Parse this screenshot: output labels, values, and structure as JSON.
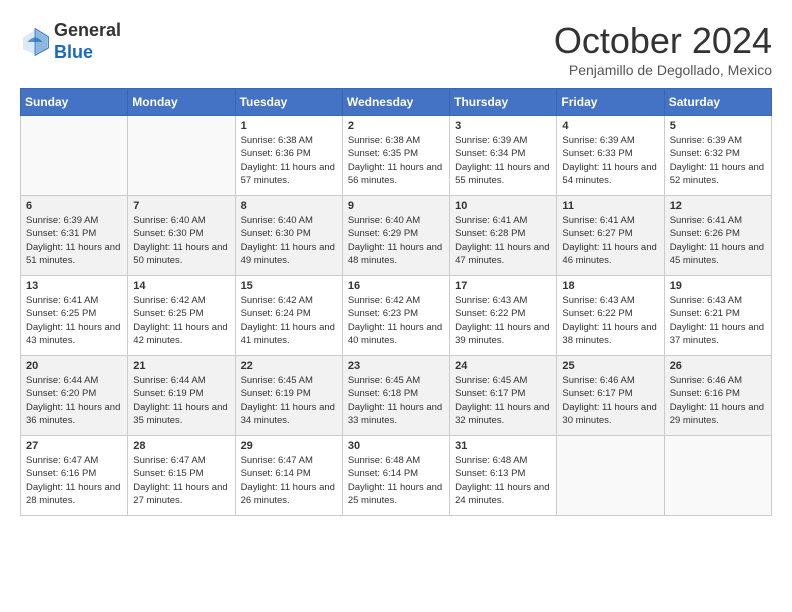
{
  "header": {
    "logo_general": "General",
    "logo_blue": "Blue",
    "month_title": "October 2024",
    "location": "Penjamillo de Degollado, Mexico"
  },
  "days_of_week": [
    "Sunday",
    "Monday",
    "Tuesday",
    "Wednesday",
    "Thursday",
    "Friday",
    "Saturday"
  ],
  "weeks": [
    [
      {
        "day": "",
        "sunrise": "",
        "sunset": "",
        "daylight": ""
      },
      {
        "day": "",
        "sunrise": "",
        "sunset": "",
        "daylight": ""
      },
      {
        "day": "1",
        "sunrise": "Sunrise: 6:38 AM",
        "sunset": "Sunset: 6:36 PM",
        "daylight": "Daylight: 11 hours and 57 minutes."
      },
      {
        "day": "2",
        "sunrise": "Sunrise: 6:38 AM",
        "sunset": "Sunset: 6:35 PM",
        "daylight": "Daylight: 11 hours and 56 minutes."
      },
      {
        "day": "3",
        "sunrise": "Sunrise: 6:39 AM",
        "sunset": "Sunset: 6:34 PM",
        "daylight": "Daylight: 11 hours and 55 minutes."
      },
      {
        "day": "4",
        "sunrise": "Sunrise: 6:39 AM",
        "sunset": "Sunset: 6:33 PM",
        "daylight": "Daylight: 11 hours and 54 minutes."
      },
      {
        "day": "5",
        "sunrise": "Sunrise: 6:39 AM",
        "sunset": "Sunset: 6:32 PM",
        "daylight": "Daylight: 11 hours and 52 minutes."
      }
    ],
    [
      {
        "day": "6",
        "sunrise": "Sunrise: 6:39 AM",
        "sunset": "Sunset: 6:31 PM",
        "daylight": "Daylight: 11 hours and 51 minutes."
      },
      {
        "day": "7",
        "sunrise": "Sunrise: 6:40 AM",
        "sunset": "Sunset: 6:30 PM",
        "daylight": "Daylight: 11 hours and 50 minutes."
      },
      {
        "day": "8",
        "sunrise": "Sunrise: 6:40 AM",
        "sunset": "Sunset: 6:30 PM",
        "daylight": "Daylight: 11 hours and 49 minutes."
      },
      {
        "day": "9",
        "sunrise": "Sunrise: 6:40 AM",
        "sunset": "Sunset: 6:29 PM",
        "daylight": "Daylight: 11 hours and 48 minutes."
      },
      {
        "day": "10",
        "sunrise": "Sunrise: 6:41 AM",
        "sunset": "Sunset: 6:28 PM",
        "daylight": "Daylight: 11 hours and 47 minutes."
      },
      {
        "day": "11",
        "sunrise": "Sunrise: 6:41 AM",
        "sunset": "Sunset: 6:27 PM",
        "daylight": "Daylight: 11 hours and 46 minutes."
      },
      {
        "day": "12",
        "sunrise": "Sunrise: 6:41 AM",
        "sunset": "Sunset: 6:26 PM",
        "daylight": "Daylight: 11 hours and 45 minutes."
      }
    ],
    [
      {
        "day": "13",
        "sunrise": "Sunrise: 6:41 AM",
        "sunset": "Sunset: 6:25 PM",
        "daylight": "Daylight: 11 hours and 43 minutes."
      },
      {
        "day": "14",
        "sunrise": "Sunrise: 6:42 AM",
        "sunset": "Sunset: 6:25 PM",
        "daylight": "Daylight: 11 hours and 42 minutes."
      },
      {
        "day": "15",
        "sunrise": "Sunrise: 6:42 AM",
        "sunset": "Sunset: 6:24 PM",
        "daylight": "Daylight: 11 hours and 41 minutes."
      },
      {
        "day": "16",
        "sunrise": "Sunrise: 6:42 AM",
        "sunset": "Sunset: 6:23 PM",
        "daylight": "Daylight: 11 hours and 40 minutes."
      },
      {
        "day": "17",
        "sunrise": "Sunrise: 6:43 AM",
        "sunset": "Sunset: 6:22 PM",
        "daylight": "Daylight: 11 hours and 39 minutes."
      },
      {
        "day": "18",
        "sunrise": "Sunrise: 6:43 AM",
        "sunset": "Sunset: 6:22 PM",
        "daylight": "Daylight: 11 hours and 38 minutes."
      },
      {
        "day": "19",
        "sunrise": "Sunrise: 6:43 AM",
        "sunset": "Sunset: 6:21 PM",
        "daylight": "Daylight: 11 hours and 37 minutes."
      }
    ],
    [
      {
        "day": "20",
        "sunrise": "Sunrise: 6:44 AM",
        "sunset": "Sunset: 6:20 PM",
        "daylight": "Daylight: 11 hours and 36 minutes."
      },
      {
        "day": "21",
        "sunrise": "Sunrise: 6:44 AM",
        "sunset": "Sunset: 6:19 PM",
        "daylight": "Daylight: 11 hours and 35 minutes."
      },
      {
        "day": "22",
        "sunrise": "Sunrise: 6:45 AM",
        "sunset": "Sunset: 6:19 PM",
        "daylight": "Daylight: 11 hours and 34 minutes."
      },
      {
        "day": "23",
        "sunrise": "Sunrise: 6:45 AM",
        "sunset": "Sunset: 6:18 PM",
        "daylight": "Daylight: 11 hours and 33 minutes."
      },
      {
        "day": "24",
        "sunrise": "Sunrise: 6:45 AM",
        "sunset": "Sunset: 6:17 PM",
        "daylight": "Daylight: 11 hours and 32 minutes."
      },
      {
        "day": "25",
        "sunrise": "Sunrise: 6:46 AM",
        "sunset": "Sunset: 6:17 PM",
        "daylight": "Daylight: 11 hours and 30 minutes."
      },
      {
        "day": "26",
        "sunrise": "Sunrise: 6:46 AM",
        "sunset": "Sunset: 6:16 PM",
        "daylight": "Daylight: 11 hours and 29 minutes."
      }
    ],
    [
      {
        "day": "27",
        "sunrise": "Sunrise: 6:47 AM",
        "sunset": "Sunset: 6:16 PM",
        "daylight": "Daylight: 11 hours and 28 minutes."
      },
      {
        "day": "28",
        "sunrise": "Sunrise: 6:47 AM",
        "sunset": "Sunset: 6:15 PM",
        "daylight": "Daylight: 11 hours and 27 minutes."
      },
      {
        "day": "29",
        "sunrise": "Sunrise: 6:47 AM",
        "sunset": "Sunset: 6:14 PM",
        "daylight": "Daylight: 11 hours and 26 minutes."
      },
      {
        "day": "30",
        "sunrise": "Sunrise: 6:48 AM",
        "sunset": "Sunset: 6:14 PM",
        "daylight": "Daylight: 11 hours and 25 minutes."
      },
      {
        "day": "31",
        "sunrise": "Sunrise: 6:48 AM",
        "sunset": "Sunset: 6:13 PM",
        "daylight": "Daylight: 11 hours and 24 minutes."
      },
      {
        "day": "",
        "sunrise": "",
        "sunset": "",
        "daylight": ""
      },
      {
        "day": "",
        "sunrise": "",
        "sunset": "",
        "daylight": ""
      }
    ]
  ]
}
